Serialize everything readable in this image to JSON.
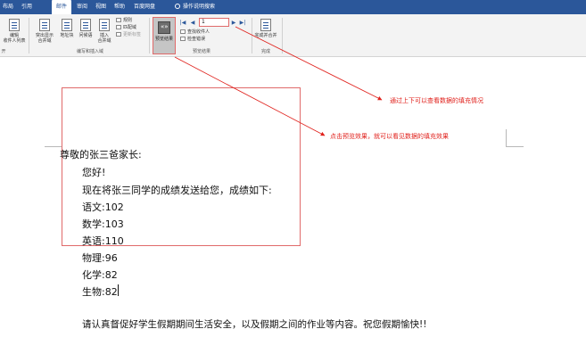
{
  "tabs": [
    {
      "label": "布局",
      "active": false
    },
    {
      "label": "引用",
      "active": false
    },
    {
      "label": "邮件",
      "active": true
    },
    {
      "label": "审阅",
      "active": false
    },
    {
      "label": "视图",
      "active": false
    },
    {
      "label": "帮助",
      "active": false
    },
    {
      "label": "百度网盘",
      "active": false
    }
  ],
  "tell_me": "操作说明搜索",
  "ribbon": {
    "edit_recipients": "编辑\n收件人列表",
    "highlight_fields": "突出显示\n合并域",
    "address_block": "地址块",
    "greeting_line": "问候语",
    "insert_merge_field": "插入\n合并域",
    "rules": "规则",
    "match_fields": "匹配域",
    "update_labels": "更新标签",
    "group_write_insert": "编写和插入域",
    "preview_results": "预览结果",
    "record_value": "1",
    "find_recipient": "查找收件人",
    "check_errors": "检查错误",
    "group_preview": "预览结果",
    "finish_merge": "完成并合并",
    "group_finish": "完成",
    "group_left_fragment": "开"
  },
  "nav": {
    "first": "|◀",
    "prev": "◀",
    "next": "▶",
    "last": "▶|"
  },
  "letter": {
    "salutation": "尊敬的张三爸家长:",
    "greeting": "您好!",
    "intro": "现在将张三同学的成绩发送给您，成绩如下:",
    "scores": [
      "语文:102",
      "数学:103",
      "英语:110",
      "物理:96",
      "化学:82",
      "生物:82"
    ],
    "closing": "请认真督促好学生假期期间生活安全，以及假期之间的作业等内容。祝您假期愉快!!"
  },
  "annotations": {
    "note_nav": "通过上下可以查看数据的填充情况",
    "note_preview": "点击预览效果，就可以看见数据的填充效果"
  },
  "colors": {
    "ribbon_tab_bg": "#2b579a",
    "annotation_red": "#e0201b"
  }
}
